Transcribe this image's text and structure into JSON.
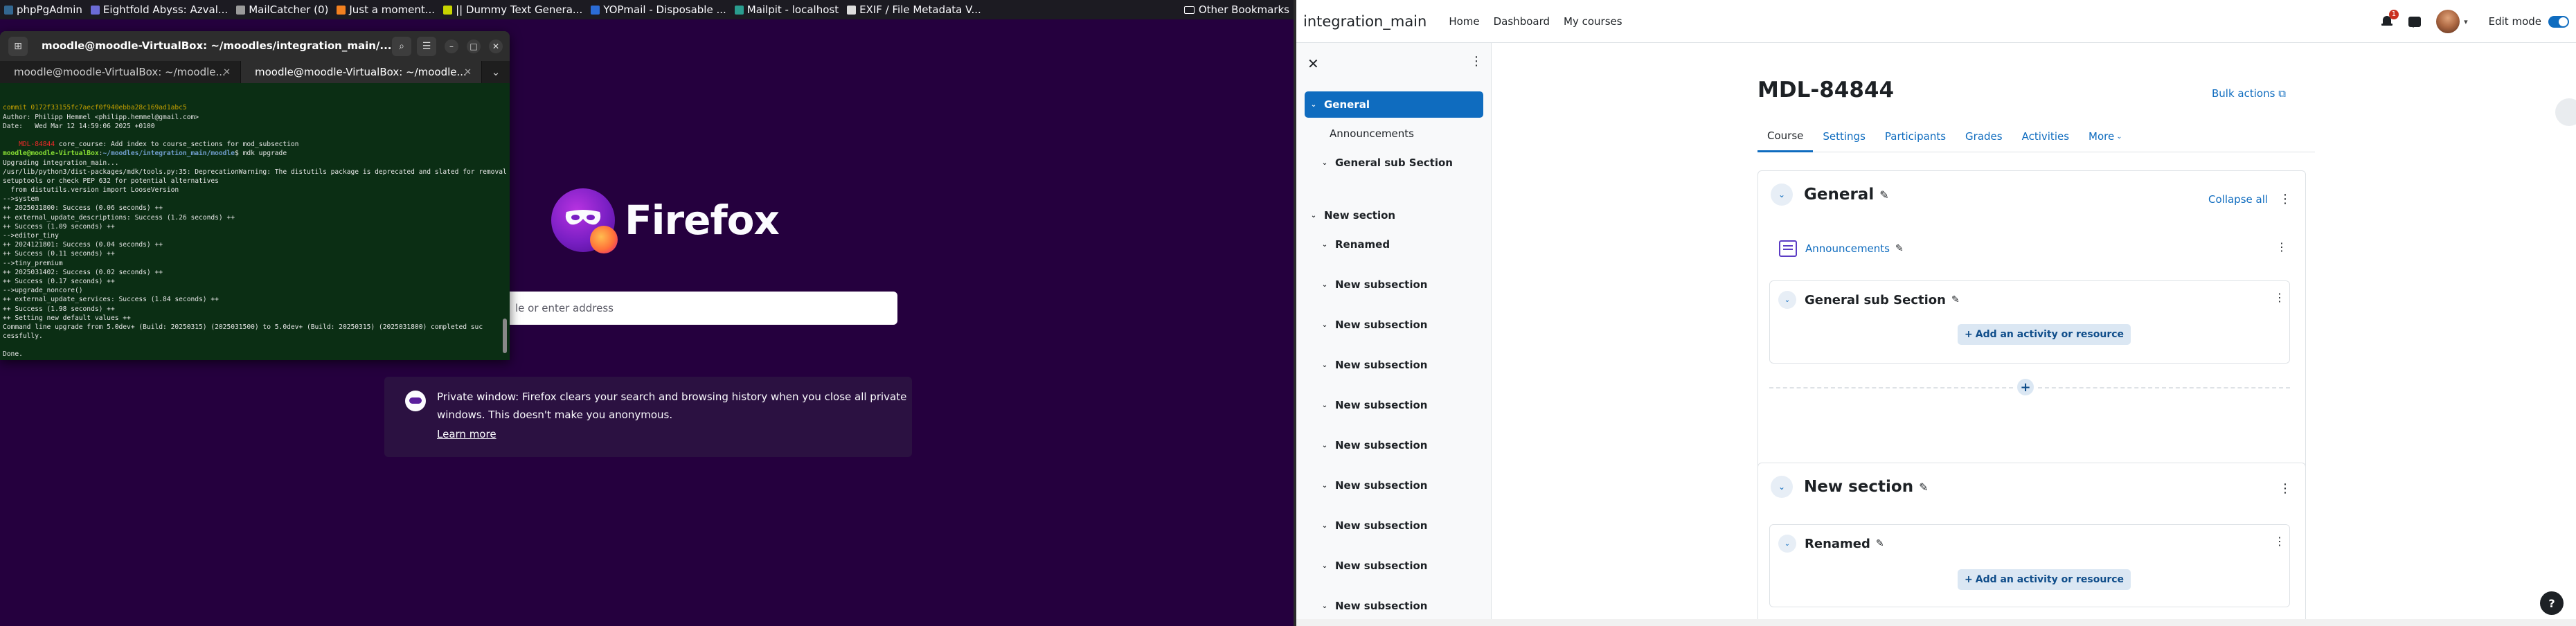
{
  "bookmarks": [
    {
      "label": "phpPgAdmin",
      "color": "#336791"
    },
    {
      "label": "Eightfold Abyss: Azval...",
      "color": "#6b6bd6"
    },
    {
      "label": "MailCatcher (0)",
      "color": "#9b9b9b"
    },
    {
      "label": "Just a moment...",
      "color": "#f38020"
    },
    {
      "label": "|| Dummy Text Genera...",
      "color": "#c7d400"
    },
    {
      "label": "YOPmail - Disposable ...",
      "color": "#2b6cd6"
    },
    {
      "label": "Mailpit - localhost",
      "color": "#2a9d8f"
    },
    {
      "label": "EXIF / File Metadata V...",
      "color": "#dddddd"
    }
  ],
  "bookmarks_other": "Other Bookmarks",
  "firefox": {
    "wordmark": "Firefox",
    "search_placeholder": "le or enter address",
    "private_notice": "Private window: Firefox clears your search and browsing history when you close all private windows. This doesn't make you anonymous.",
    "learn_more": "Learn more"
  },
  "terminal": {
    "title": "moodle@moodle-VirtualBox: ~/moodles/integration_main/...",
    "tabs": [
      {
        "label": "moodle@moodle-VirtualBox: ~/moodle...",
        "active": false
      },
      {
        "label": "moodle@moodle-VirtualBox: ~/moodle...",
        "active": true
      }
    ],
    "lines": [
      {
        "t": "commit 0172f33155fc7aecf0f940ebba28c169ad1abc5",
        "c": "y"
      },
      {
        "t": "Author: Philipp Hemmel <philipp.hemmel@gmail.com>",
        "c": ""
      },
      {
        "t": "Date:   Wed Mar 12 14:59:06 2025 +0100",
        "c": ""
      },
      {
        "t": "",
        "c": ""
      },
      {
        "t": "    MDL-84844 core_course: Add index to course_sections for mod_subsection",
        "c": "mdl"
      },
      {
        "t": "moodle@moodle-VirtualBox:~/moodles/integration_main/moodle$ mdk upgrade",
        "c": "prompt"
      },
      {
        "t": "Upgrading integration_main...",
        "c": ""
      },
      {
        "t": "/usr/lib/python3/dist-packages/mdk/tools.py:35: DeprecationWarning: The distutils package is deprecated and slated for removal in Python 3.12. Use",
        "c": ""
      },
      {
        "t": "setuptools or check PEP 632 for potential alternatives",
        "c": ""
      },
      {
        "t": "  from distutils.version import LooseVersion",
        "c": ""
      },
      {
        "t": "-->system",
        "c": ""
      },
      {
        "t": "++ 2025031800: Success (0.06 seconds) ++",
        "c": ""
      },
      {
        "t": "++ external_update_descriptions: Success (1.26 seconds) ++",
        "c": ""
      },
      {
        "t": "++ Success (1.09 seconds) ++",
        "c": ""
      },
      {
        "t": "-->editor_tiny",
        "c": ""
      },
      {
        "t": "++ 2024121801: Success (0.04 seconds) ++",
        "c": ""
      },
      {
        "t": "++ Success (0.11 seconds) ++",
        "c": ""
      },
      {
        "t": "-->tiny_premium",
        "c": ""
      },
      {
        "t": "++ 2025031402: Success (0.02 seconds) ++",
        "c": ""
      },
      {
        "t": "++ Success (0.17 seconds) ++",
        "c": ""
      },
      {
        "t": "-->upgrade_noncore()",
        "c": ""
      },
      {
        "t": "++ external_update_services: Success (1.84 seconds) ++",
        "c": ""
      },
      {
        "t": "++ Success (1.98 seconds) ++",
        "c": ""
      },
      {
        "t": "++ Setting new default values ++",
        "c": ""
      },
      {
        "t": "Command line upgrade from 5.0dev+ (Build: 20250315) (2025031500) to 5.0dev+ (Build: 20250315) (2025031800) completed suc",
        "c": ""
      },
      {
        "t": "cessfully.",
        "c": ""
      },
      {
        "t": "",
        "c": ""
      },
      {
        "t": "Done.",
        "c": ""
      },
      {
        "t": "moodle@moodle-VirtualBox:~/moodles/integration_main/moodle$ ",
        "c": "prompt"
      }
    ]
  },
  "moodle": {
    "site_name": "integration_main",
    "nav": [
      "Home",
      "Dashboard",
      "My courses"
    ],
    "notification_count": "1",
    "edit_mode_label": "Edit mode",
    "drawer": [
      {
        "label": "General",
        "kind": "active"
      },
      {
        "label": "Announcements",
        "kind": "plain"
      },
      {
        "label": "General sub Section",
        "kind": "sub"
      },
      {
        "label": "New section",
        "kind": "section"
      },
      {
        "label": "Renamed",
        "kind": "sub"
      },
      {
        "label": "New subsection",
        "kind": "sub"
      },
      {
        "label": "New subsection",
        "kind": "sub"
      },
      {
        "label": "New subsection",
        "kind": "sub"
      },
      {
        "label": "New subsection",
        "kind": "sub"
      },
      {
        "label": "New subsection",
        "kind": "sub"
      },
      {
        "label": "New subsection",
        "kind": "sub"
      },
      {
        "label": "New subsection",
        "kind": "sub"
      },
      {
        "label": "New subsection",
        "kind": "sub"
      },
      {
        "label": "New subsection",
        "kind": "sub"
      }
    ],
    "course_title": "MDL-84844",
    "bulk_actions": "Bulk actions",
    "tabs": [
      "Course",
      "Settings",
      "Participants",
      "Grades",
      "Activities",
      "More"
    ],
    "collapse_all": "Collapse all",
    "sections": {
      "general": {
        "title": "General",
        "activity": "Announcements",
        "subsection": "General sub Section",
        "add_label": "Add an activity or resource"
      },
      "new_section": {
        "title": "New section",
        "subsection": "Renamed",
        "add_label": "Add an activity or resource"
      }
    },
    "help": "?"
  }
}
